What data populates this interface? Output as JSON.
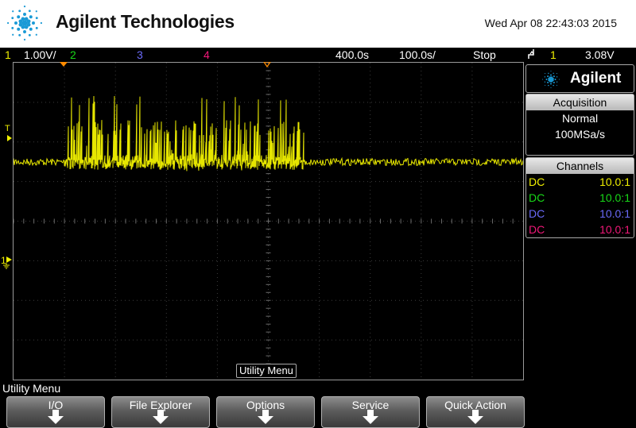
{
  "header": {
    "brand": "Agilent Technologies",
    "datetime": "Wed Apr 08 22:43:03 2015",
    "logo_icon": "agilent-spark-icon"
  },
  "status_bar": {
    "ch1_num": "1",
    "ch1_scale": "1.00V/",
    "ch2_num": "2",
    "ch3_num": "3",
    "ch4_num": "4",
    "time_delay": "400.0s",
    "time_scale": "100.0s/",
    "run_state": "Stop",
    "trigger_icon": "trigger-edge-icon",
    "trigger_source": "1",
    "trigger_level": "3.08V"
  },
  "graticule": {
    "trigger_marker": "T",
    "ground_marker": "1"
  },
  "panel": {
    "logo_text": "Agilent",
    "acquisition": {
      "title": "Acquisition",
      "mode": "Normal",
      "rate": "100MSa/s"
    },
    "channels": {
      "title": "Channels",
      "rows": [
        {
          "coupling": "DC",
          "probe": "10.0:1",
          "color": "#f0f000"
        },
        {
          "coupling": "DC",
          "probe": "10.0:1",
          "color": "#18d818"
        },
        {
          "coupling": "DC",
          "probe": "10.0:1",
          "color": "#6a6af8"
        },
        {
          "coupling": "DC",
          "probe": "10.0:1",
          "color": "#f01878"
        }
      ]
    }
  },
  "menu": {
    "inline_label": "Utility Menu",
    "title": "Utility Menu",
    "softkeys": [
      "I/O",
      "File Explorer",
      "Options",
      "Service",
      "Quick Action"
    ]
  },
  "colors": {
    "ch1": "#f0f000",
    "ch2": "#18d818",
    "ch3": "#6a6af8",
    "ch4": "#f01878",
    "trigger_marker": "#ff8c00"
  }
}
